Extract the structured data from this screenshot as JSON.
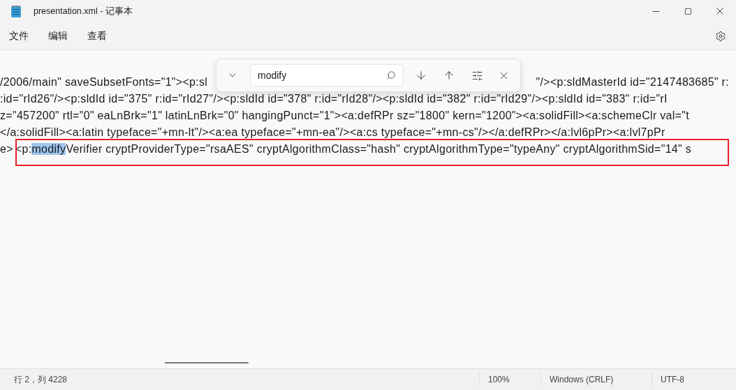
{
  "window": {
    "title": "presentation.xml - 记事本"
  },
  "menu": [
    {
      "label": "文件"
    },
    {
      "label": "编辑"
    },
    {
      "label": "查看"
    }
  ],
  "find": {
    "value": "modify"
  },
  "editor": {
    "lines": [
      {
        "kind": "split",
        "left": "/2006/main\" saveSubsetFonts=\"1\"><p:sl",
        "right": "\"/><p:sldMasterId id=\"2147483685\" r:"
      },
      {
        "kind": "plain",
        "text": ":id=\"rId26\"/><p:sldId id=\"375\" r:id=\"rId27\"/><p:sldId id=\"378\" r:id=\"rId28\"/><p:sldId id=\"382\" r:id=\"rId29\"/><p:sldId id=\"383\" r:id=\"rI"
      },
      {
        "kind": "plain",
        "text": "z=\"457200\" rtl=\"0\" eaLnBrk=\"1\" latinLnBrk=\"0\" hangingPunct=\"1\"><a:defRPr sz=\"1800\" kern=\"1200\"><a:solidFill><a:schemeClr val=\"t"
      },
      {
        "kind": "plain",
        "text": "</a:solidFill><a:latin typeface=\"+mn-lt\"/><a:ea typeface=\"+mn-ea\"/><a:cs typeface=\"+mn-cs\"/></a:defRPr></a:lvl6pPr><a:lvl7pPr"
      },
      {
        "kind": "match",
        "before": "e>",
        "prefix": "<p:",
        "match": "modify",
        "after": "Verifier cryptProviderType=\"rsaAES\" cryptAlgorithmClass=\"hash\" cryptAlgorithmType=\"typeAny\" cryptAlgorithmSid=\"14\" s"
      }
    ]
  },
  "status_bar": {
    "position": "行 2，列 4228",
    "zoom": "100%",
    "line_ending": "Windows (CRLF)",
    "encoding": "UTF-8"
  }
}
